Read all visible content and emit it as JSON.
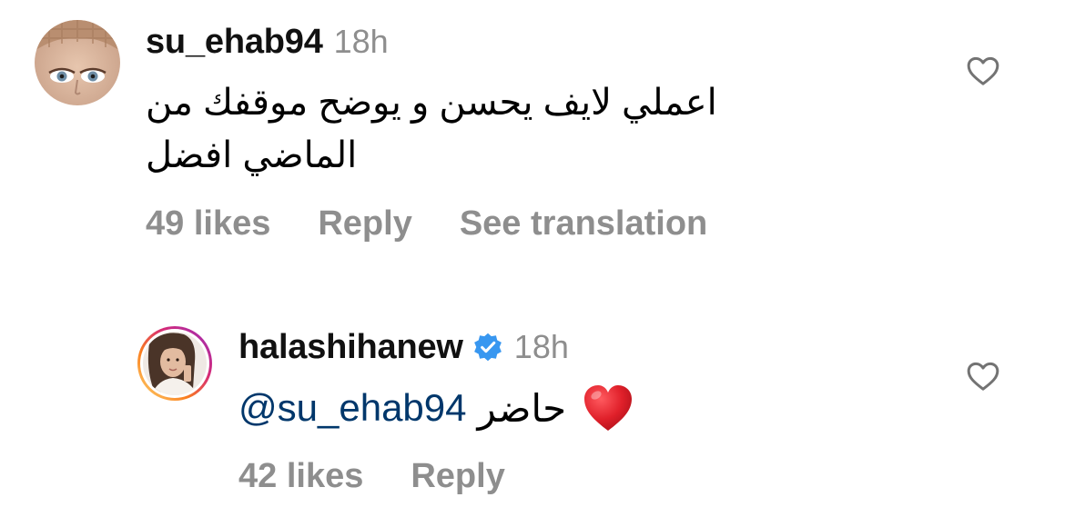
{
  "comments": [
    {
      "username": "su_ehab94",
      "time": "18h",
      "verified": false,
      "text_lines": [
        "اعملي لايف يحسن و يوضح موقفك من",
        "الماضي افضل"
      ],
      "actions": {
        "likes": "49 likes",
        "reply": "Reply",
        "translate": "See translation"
      }
    },
    {
      "username": "halashihanew",
      "time": "18h",
      "verified": true,
      "mention": "@su_ehab94",
      "text": "حاضر",
      "emoji": "heart",
      "actions": {
        "likes": "42 likes",
        "reply": "Reply"
      }
    }
  ],
  "colors": {
    "secondary_text": "#8e8e8e",
    "mention": "#00376b",
    "verified_badge": "#3897f0",
    "heart_emoji": "#e0202a"
  }
}
